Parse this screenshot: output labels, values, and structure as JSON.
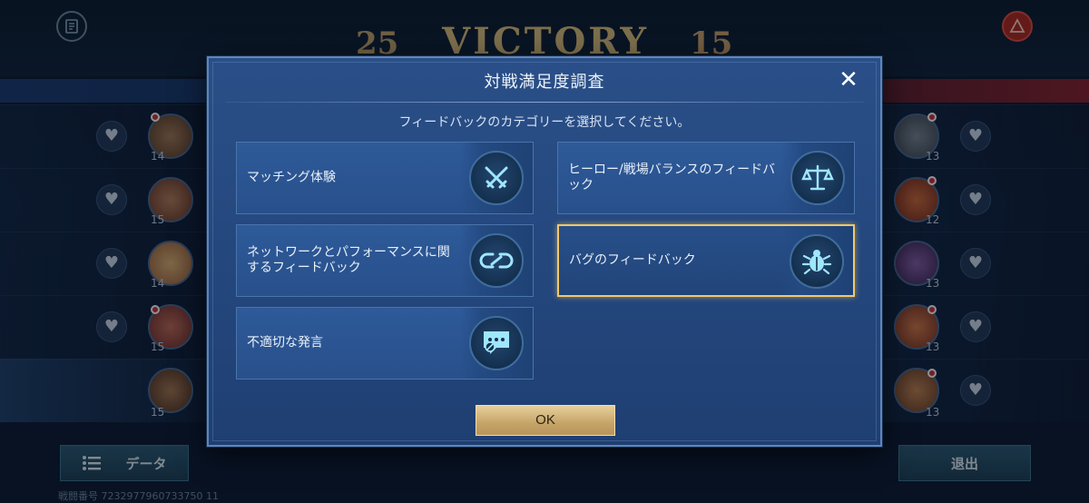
{
  "background": {
    "score_left": "25",
    "score_right": "15",
    "victory_text": "VICTORY",
    "left_levels": [
      "14",
      "15",
      "14",
      "15",
      "15"
    ],
    "right_levels": [
      "13",
      "12",
      "13",
      "13",
      "13"
    ],
    "data_button": "データ",
    "exit_button": "退出",
    "match_id": "戦闘番号 7232977960733750 11"
  },
  "dialog": {
    "title": "対戦満足度調査",
    "close_glyph": "✕",
    "instruction": "フィードバックのカテゴリーを選択してください。",
    "options": [
      {
        "label": "マッチング体験",
        "icon": "crossed-swords-icon"
      },
      {
        "label": "ヒーロー/戦場バランスのフィードバック",
        "icon": "balance-scale-icon"
      },
      {
        "label": "ネットワークとパフォーマンスに関するフィードバック",
        "icon": "link-icon"
      },
      {
        "label": "バグのフィードバック",
        "icon": "bug-icon"
      },
      {
        "label": "不適切な発言",
        "icon": "chat-block-icon"
      }
    ],
    "selected_option_index": 3,
    "ok_button": "OK"
  },
  "colors": {
    "dialog_bg": "#23467c",
    "selected_border": "#f1c86a",
    "ok_button": "#c6a468"
  }
}
